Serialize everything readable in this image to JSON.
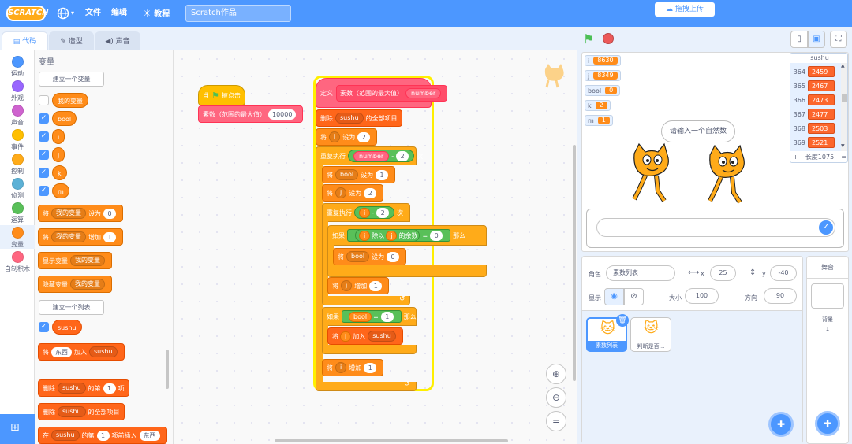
{
  "menubar": {
    "logo": "SCRATCH",
    "file": "文件",
    "edit": "编辑",
    "tutorials": "教程",
    "project_title": "Scratch作品",
    "upload": "拖拽上传"
  },
  "tabs": {
    "code": "代码",
    "costumes": "造型",
    "sounds": "声音"
  },
  "categories": [
    {
      "label": "运动",
      "color": "#4c97ff"
    },
    {
      "label": "外观",
      "color": "#9966ff"
    },
    {
      "label": "声音",
      "color": "#cf63cf"
    },
    {
      "label": "事件",
      "color": "#ffbf00"
    },
    {
      "label": "控制",
      "color": "#ffab19"
    },
    {
      "label": "侦测",
      "color": "#5cb1d6"
    },
    {
      "label": "运算",
      "color": "#59c059"
    },
    {
      "label": "变量",
      "color": "#ff8c1a"
    },
    {
      "label": "自制积木",
      "color": "#ff6680"
    }
  ],
  "palette": {
    "heading": "变量",
    "make_var": "建立一个变量",
    "vars": [
      "我的变量",
      "bool",
      "i",
      "j",
      "k",
      "m"
    ],
    "set_kw": "将",
    "set_to": "设为",
    "change_by": "增加",
    "show_var": "显示变量",
    "hide_var": "隐藏变量",
    "my_var": "我的变量",
    "zero": "0",
    "one": "1",
    "make_list": "建立一个列表",
    "list_name": "sushu",
    "thing": "东西",
    "add_to": "加入",
    "delete": "删除",
    "item_of": "的第",
    "item": "项",
    "all_items": "的全部项目",
    "insert_at": "在",
    "insert_kw": "项前插入",
    "thing_short": "东西"
  },
  "script1": {
    "when": "当",
    "clicked": "被点击",
    "call": "素数（范围的最大值）",
    "arg": "10000"
  },
  "script2": {
    "define": "定义",
    "proc": "素数（范围的最大值）",
    "param": "number",
    "delete_all": "删除",
    "list": "sushu",
    "all_items": "的全部项目",
    "set": "将",
    "set_to": "设为",
    "i": "i",
    "j": "j",
    "bool": "bool",
    "two": "2",
    "one": "1",
    "zero": "0",
    "repeat": "重复执行",
    "times": "次",
    "minus": "-",
    "if": "如果",
    "then": "那么",
    "mod_div": "除以",
    "mod_rem": "的余数",
    "eq": "=",
    "change": "增加",
    "add": "加入"
  },
  "monitors": [
    {
      "name": "i",
      "value": "8630"
    },
    {
      "name": "j",
      "value": "8349"
    },
    {
      "name": "bool",
      "value": "0"
    },
    {
      "name": "k",
      "value": "2"
    },
    {
      "name": "m",
      "value": "1"
    }
  ],
  "list_monitor": {
    "title": "sushu",
    "rows": [
      {
        "idx": "364",
        "val": "2459"
      },
      {
        "idx": "365",
        "val": "2467"
      },
      {
        "idx": "366",
        "val": "2473"
      },
      {
        "idx": "367",
        "val": "2477"
      },
      {
        "idx": "368",
        "val": "2503"
      },
      {
        "idx": "369",
        "val": "2521"
      }
    ],
    "add": "+",
    "length": "长度1075",
    "eq": "="
  },
  "speech": "请输入一个自然数",
  "sprite": {
    "label": "角色",
    "name": "素数列表",
    "x_label": "x",
    "x": "25",
    "y_label": "y",
    "y": "-40",
    "show_label": "显示",
    "size_label": "大小",
    "size": "100",
    "dir_label": "方向",
    "dir": "90",
    "sprites": [
      "素数列表",
      "判断是否..."
    ]
  },
  "stage_pane": {
    "title": "舞台",
    "backdrop_label": "背景",
    "backdrop_count": "1"
  }
}
